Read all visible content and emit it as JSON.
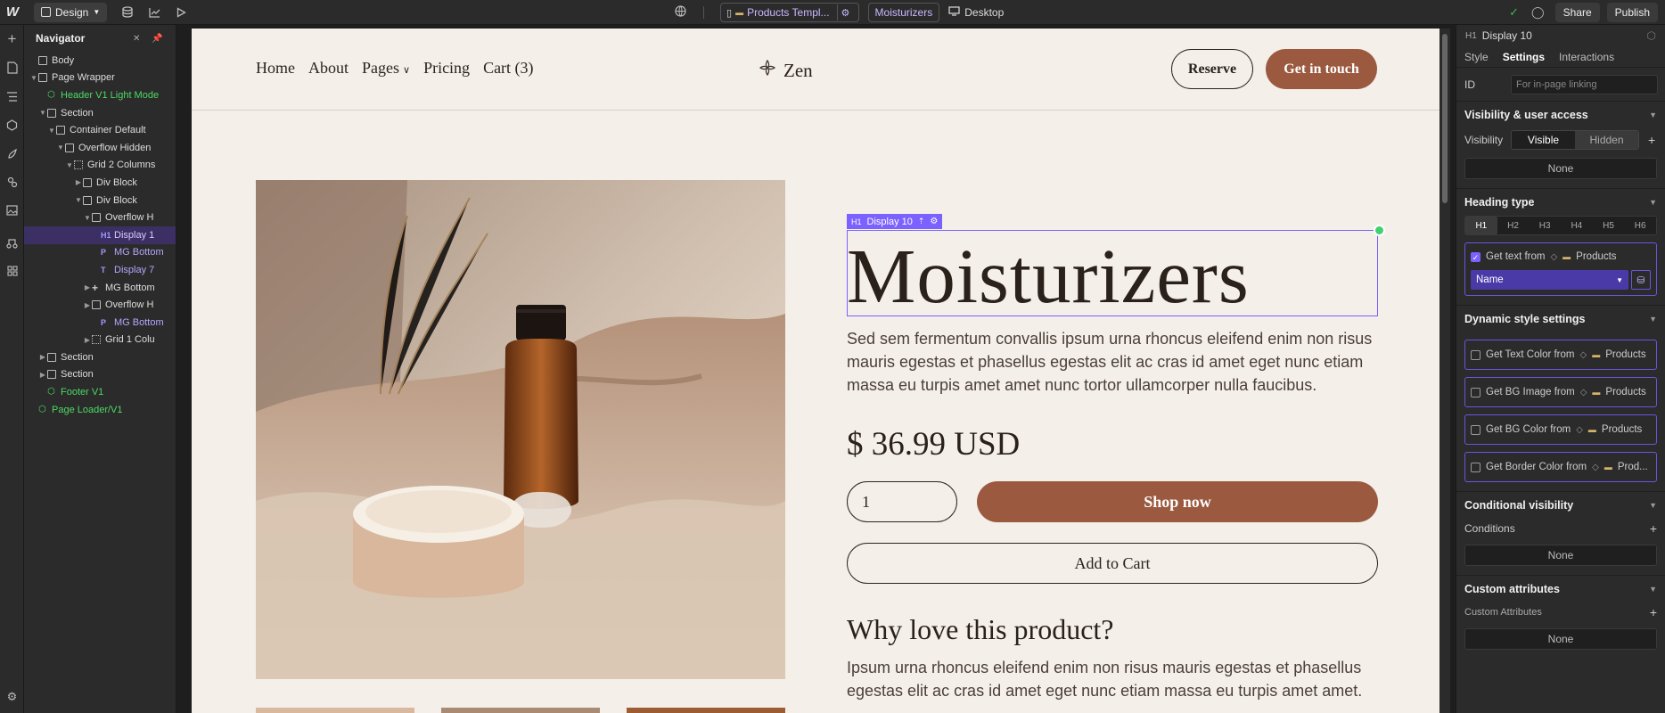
{
  "topbar": {
    "mode": "Design",
    "page_name": "Products Templ...",
    "collection": "Moisturizers",
    "device": "Desktop",
    "share": "Share",
    "publish": "Publish"
  },
  "navigator": {
    "title": "Navigator",
    "items": [
      {
        "label": "Body"
      },
      {
        "label": "Page Wrapper"
      },
      {
        "label": "Header V1 Light Mode"
      },
      {
        "label": "Section"
      },
      {
        "label": "Container Default"
      },
      {
        "label": "Overflow Hidden"
      },
      {
        "label": "Grid 2 Columns"
      },
      {
        "label": "Div Block"
      },
      {
        "label": "Div Block"
      },
      {
        "label": "Overflow H"
      },
      {
        "label": "Display 1"
      },
      {
        "label": "MG Bottom"
      },
      {
        "label": "Display 7"
      },
      {
        "label": "MG Bottom"
      },
      {
        "label": "Overflow H"
      },
      {
        "label": "MG Bottom"
      },
      {
        "label": "Grid 1 Colu"
      },
      {
        "label": "Section"
      },
      {
        "label": "Section"
      },
      {
        "label": "Footer V1"
      },
      {
        "label": "Page Loader/V1"
      }
    ]
  },
  "canvas": {
    "nav_links": [
      "Home",
      "About",
      "Pages",
      "Pricing",
      "Cart (3)"
    ],
    "brand": "Zen",
    "reserve": "Reserve",
    "get_in_touch": "Get in touch",
    "label_tag": "Display 10",
    "heading": "Moisturizers",
    "description": "Sed sem fermentum convallis ipsum urna rhoncus eleifend enim non risus mauris egestas et phasellus egestas elit ac cras id amet eget nunc etiam massa eu turpis amet amet nunc tortor ullamcorper nulla faucibus.",
    "price": "$ 36.99 USD",
    "quantity": "1",
    "shop_now": "Shop now",
    "add_to_cart": "Add to Cart",
    "why_title": "Why love this product?",
    "why_text": "Ipsum urna rhoncus eleifend enim non risus mauris egestas et phasellus egestas elit ac cras id amet eget nunc etiam massa eu turpis amet amet."
  },
  "panel": {
    "element": "Display 10",
    "tabs": [
      "Style",
      "Settings",
      "Interactions"
    ],
    "id_label": "ID",
    "id_placeholder": "For in-page linking",
    "visibility_title": "Visibility & user access",
    "visibility_label": "Visibility",
    "visible": "Visible",
    "hidden": "Hidden",
    "none": "None",
    "heading_type_title": "Heading type",
    "heading_levels": [
      "H1",
      "H2",
      "H3",
      "H4",
      "H5",
      "H6"
    ],
    "get_text_from": "Get text from",
    "products": "Products",
    "name_field": "Name",
    "dynamic_title": "Dynamic style settings",
    "dynamic_items": [
      {
        "label": "Get Text Color from",
        "source": "Products"
      },
      {
        "label": "Get BG Image from",
        "source": "Products"
      },
      {
        "label": "Get BG Color from",
        "source": "Products"
      },
      {
        "label": "Get Border Color from",
        "source": "Prod..."
      }
    ],
    "conditional_title": "Conditional visibility",
    "conditions": "Conditions",
    "custom_attr_title": "Custom attributes",
    "custom_attributes": "Custom Attributes"
  }
}
